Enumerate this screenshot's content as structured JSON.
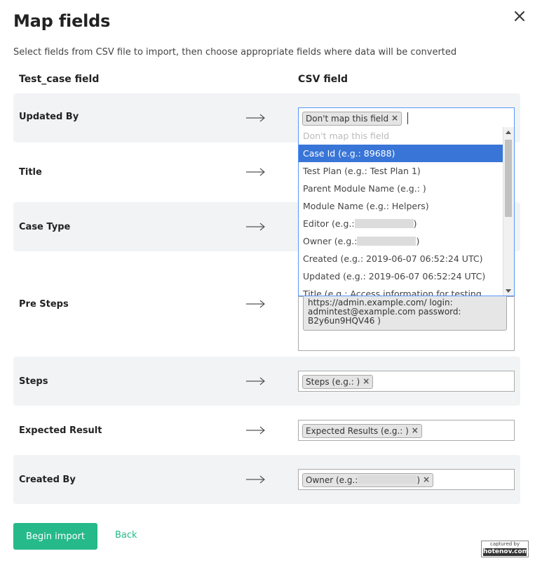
{
  "dialog": {
    "title": "Map fields",
    "subtitle": "Select fields from CSV file to import, then choose appropriate fields where data will be converted",
    "close_icon": "close-icon"
  },
  "columns": {
    "left": "Test_case field",
    "right": "CSV field"
  },
  "rows": [
    {
      "label": "Updated By",
      "value": "Don't map this field"
    },
    {
      "label": "Title",
      "value": ""
    },
    {
      "label": "Case Type",
      "value": ""
    },
    {
      "label": "Pre Steps",
      "value_lines": [
        "https://admin.example.com/ login:",
        "admintest@example.com password:",
        "B2y6un9HQV46 )"
      ]
    },
    {
      "label": "Steps",
      "value": "Steps (e.g.: )"
    },
    {
      "label": "Expected Result",
      "value": "Expected Results (e.g.: )"
    },
    {
      "label": "Created By",
      "value_prefix": "Owner (e.g.:",
      "value_suffix": ")"
    }
  ],
  "dropdown": {
    "options": [
      {
        "text": "Don't map this field",
        "state": "disabled"
      },
      {
        "text": "Case Id (e.g.: 89688)",
        "state": "selected"
      },
      {
        "text": "Test Plan (e.g.: Test Plan 1)"
      },
      {
        "text": "Parent Module Name (e.g.: )"
      },
      {
        "text": "Module Name (e.g.: Helpers)"
      },
      {
        "prefix": "Editor (e.g.:",
        "suffix": ")"
      },
      {
        "prefix": "Owner (e.g.:",
        "suffix": ")"
      },
      {
        "text": "Created (e.g.: 2019-06-07 06:52:24 UTC)"
      },
      {
        "text": "Updated (e.g.: 2019-06-07 06:52:24 UTC)"
      },
      {
        "text": "Title (e.g.: Access information for testing"
      }
    ]
  },
  "actions": {
    "begin_import": "Begin import",
    "back": "Back"
  },
  "badge": {
    "line1": "captured by",
    "line2": "hotenov.com"
  },
  "colors": {
    "accent": "#26b98a",
    "selected_option": "#3875d7",
    "row_shade": "#f2f3f5"
  }
}
